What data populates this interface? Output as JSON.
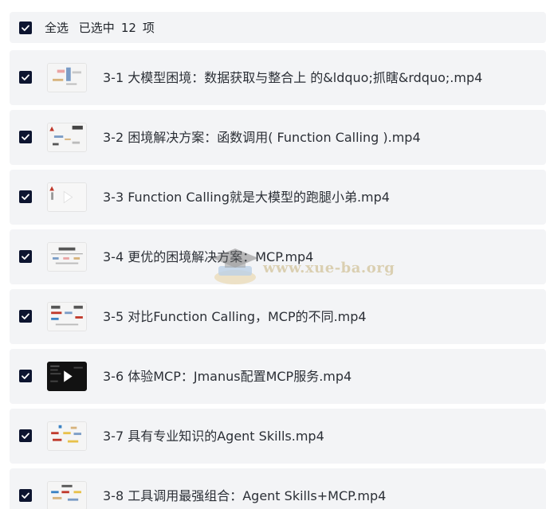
{
  "header": {
    "select_all_label": "全选",
    "selected_prefix": "已选中",
    "selected_count": "12",
    "selected_suffix": "项"
  },
  "files": [
    {
      "title": "3-1 大模型困境：数据获取与整合上 的&ldquo;抓瞎&rdquo;.mp4",
      "checked": true,
      "thumb_icon": "slide-thumbnail-icon"
    },
    {
      "title": "3-2 困境解决方案：函数调用( Function Calling ).mp4",
      "checked": true,
      "thumb_icon": "slide-thumbnail-icon"
    },
    {
      "title": "3-3 Function Calling就是大模型的跑腿小弟.mp4",
      "checked": true,
      "thumb_icon": "play-thumbnail-icon"
    },
    {
      "title": "3-4 更优的困境解决方案：MCP.mp4",
      "checked": true,
      "thumb_icon": "slide-thumbnail-icon"
    },
    {
      "title": "3-5 对比Function Calling，MCP的不同.mp4",
      "checked": true,
      "thumb_icon": "slide-thumbnail-icon"
    },
    {
      "title": "3-6 体验MCP：Jmanus配置MCP服务.mp4",
      "checked": true,
      "thumb_icon": "play-thumbnail-icon"
    },
    {
      "title": "3-7 具有专业知识的Agent Skills.mp4",
      "checked": true,
      "thumb_icon": "slide-thumbnail-icon"
    },
    {
      "title": "3-8 工具调用最强组合：Agent Skills+MCP.mp4",
      "checked": true,
      "thumb_icon": "slide-thumbnail-icon"
    }
  ],
  "watermark": {
    "text": "www.xue-ba.org",
    "icon": "graduation-cap-icon"
  },
  "colors": {
    "checkbox": "#0d1530",
    "row_background": "#f3f4f6",
    "text": "#2b2f36",
    "watermark": "#c7b27a"
  }
}
